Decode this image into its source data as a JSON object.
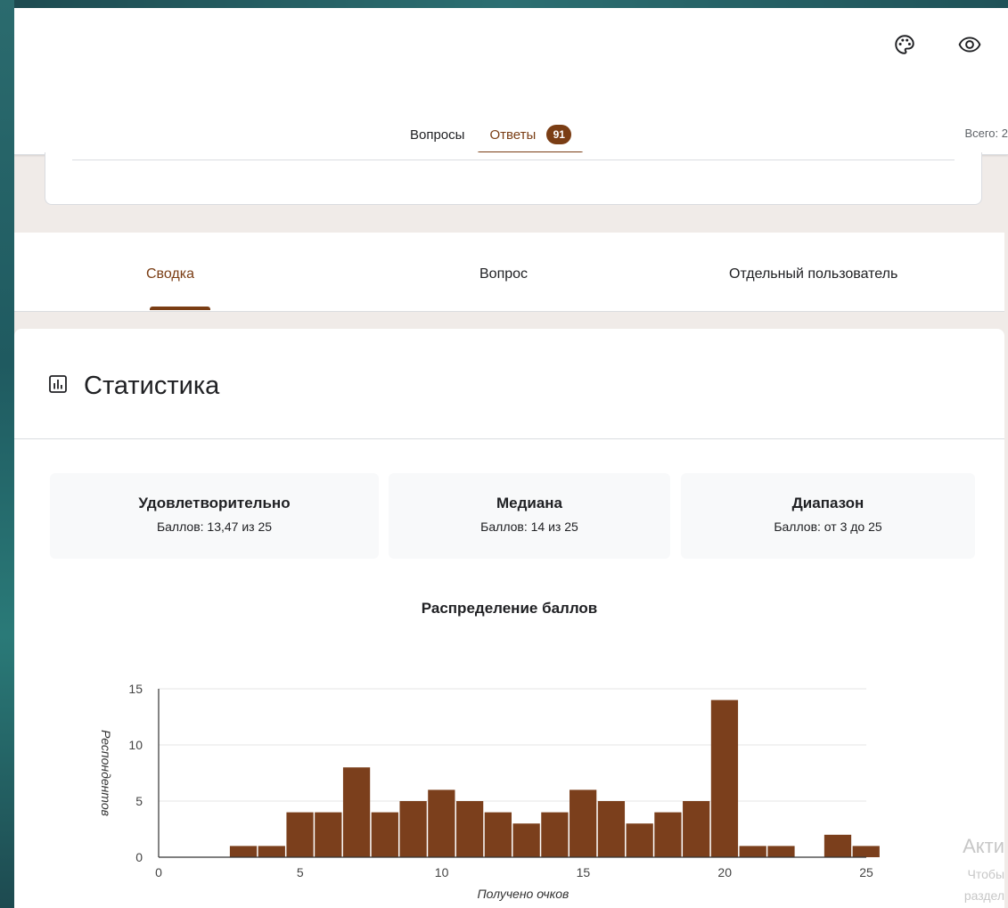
{
  "header": {
    "tabs": [
      {
        "label": "Вопросы",
        "active": false
      },
      {
        "label": "Ответы",
        "active": true
      }
    ],
    "responses_count": "91",
    "total_label": "Всего: 2",
    "icons": [
      "palette-icon",
      "eye-icon"
    ]
  },
  "subtabs": [
    {
      "label": "Сводка",
      "active": true
    },
    {
      "label": "Вопрос",
      "active": false
    },
    {
      "label": "Отдельный пользователь",
      "active": false
    }
  ],
  "stats": {
    "title": "Статистика",
    "cards": [
      {
        "title": "Удовлетворительно",
        "value": "Баллов: 13,47 из 25"
      },
      {
        "title": "Медиана",
        "value": "Баллов: 14 из 25"
      },
      {
        "title": "Диапазон",
        "value": "Баллов: от 3 до 25"
      }
    ]
  },
  "chart_data": {
    "type": "bar",
    "title": "Распределение баллов",
    "xlabel": "Получено очков",
    "ylabel": "Респондентов",
    "x": [
      0,
      1,
      2,
      3,
      4,
      5,
      6,
      7,
      8,
      9,
      10,
      11,
      12,
      13,
      14,
      15,
      16,
      17,
      18,
      19,
      20,
      21,
      22,
      23,
      24,
      25
    ],
    "values": [
      0,
      0,
      0,
      1,
      1,
      4,
      4,
      8,
      4,
      5,
      6,
      5,
      4,
      3,
      4,
      6,
      5,
      3,
      4,
      5,
      14,
      1,
      1,
      0,
      2,
      1
    ],
    "xlim": [
      0,
      25
    ],
    "ylim": [
      0,
      15
    ],
    "xticks": [
      "0",
      "5",
      "10",
      "15",
      "20",
      "25"
    ],
    "yticks": [
      "0",
      "5",
      "10",
      "15"
    ],
    "grid": true,
    "color": "#7b3f1c"
  },
  "watermark": {
    "line1": "Акти",
    "line2": "Чтобы",
    "line3": "раздел"
  },
  "colors": {
    "accent": "#7a3d14",
    "bar": "#7b3f1c"
  }
}
